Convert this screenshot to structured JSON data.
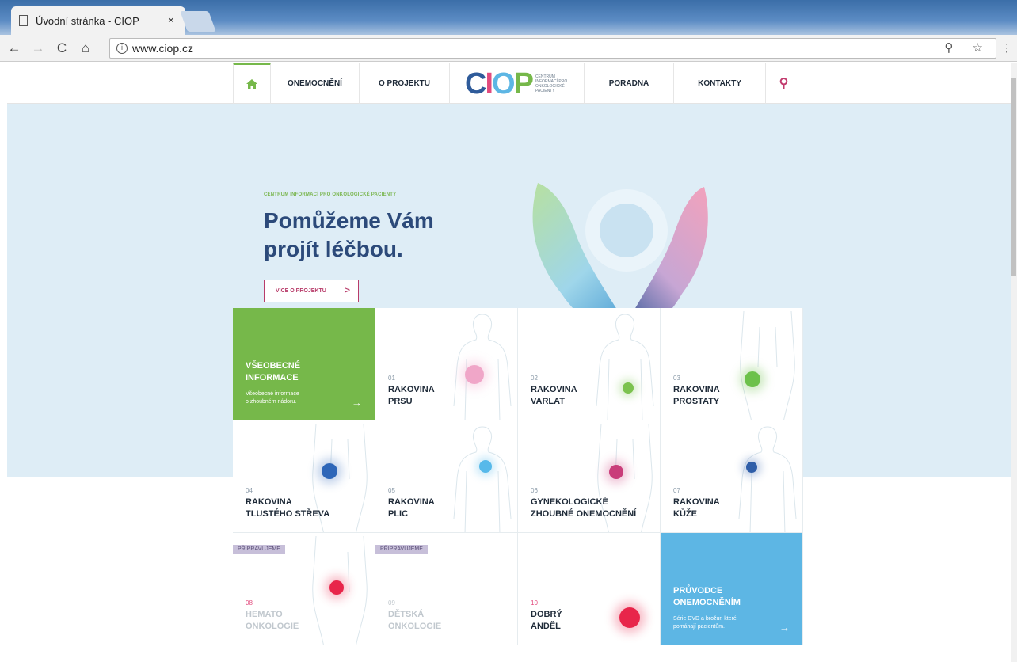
{
  "browser": {
    "tab_title": "Úvodní stránka - CIOP",
    "tab_close": "×",
    "url": "www.ciop.cz",
    "info_glyph": "i",
    "right_icons": "⚲ ☆",
    "menu_glyph": "⋮",
    "nav": {
      "back": "←",
      "forward": "→",
      "reload": "C",
      "home": "⌂"
    }
  },
  "nav": {
    "home_icon": "home-icon",
    "items": [
      "ONEMOCNĚNÍ",
      "O PROJEKTU",
      "PORADNA",
      "KONTAKTY"
    ],
    "search_icon": "search-icon",
    "search_glyph": "⚲"
  },
  "logo": {
    "text": "CIOP",
    "tagline": "CENTRUM INFORMACÍ PRO ONKOLOGICKÉ PACIENTY",
    "colors": [
      "#2f5b9a",
      "#e24a7d",
      "#5db6e4",
      "#76b84a"
    ]
  },
  "hero": {
    "kicker": "CENTRUM INFORMACÍ PRO ONKOLOGICKÉ PACIENTY",
    "headline_line1": "Pomůžeme Vám",
    "headline_line2": "projít léčbou.",
    "cta_label": "VÍCE O PROJEKTU",
    "cta_arrow": ">"
  },
  "cards": {
    "general": {
      "title_line1": "VŠEOBECNÉ",
      "title_line2": "INFORMACE",
      "desc_line1": "Všeobecné informace",
      "desc_line2": "o zhoubném nádoru.",
      "arrow": "→"
    },
    "items": [
      {
        "num": "01",
        "line1": "RAKOVINA",
        "line2": "PRSU",
        "dot": "#f0a6c8"
      },
      {
        "num": "02",
        "line1": "RAKOVINA",
        "line2": "VARLAT",
        "dot": "#7cc24f"
      },
      {
        "num": "03",
        "line1": "RAKOVINA",
        "line2": "PROSTATY",
        "dot": "#6cc14a"
      },
      {
        "num": "04",
        "line1": "RAKOVINA",
        "line2": "TLUSTÉHO STŘEVA",
        "dot": "#2e66b8"
      },
      {
        "num": "05",
        "line1": "RAKOVINA",
        "line2": "PLIC",
        "dot": "#57b9ea"
      },
      {
        "num": "06",
        "line1": "GYNEKOLOGICKÉ",
        "line2": "ZHOUBNÉ ONEMOCNĚNÍ",
        "dot": "#c93d7a"
      },
      {
        "num": "07",
        "line1": "RAKOVINA",
        "line2": "KŮŽE",
        "dot": "#2f5ea8"
      },
      {
        "num": "08",
        "line1": "HEMATO",
        "line2": "ONKOLOGIE",
        "dot": "#e8254a",
        "badge": "PŘIPRAVUJEME"
      },
      {
        "num": "09",
        "line1": "DĚTSKÁ",
        "line2": "ONKOLOGIE",
        "badge": "PŘIPRAVUJEME"
      },
      {
        "num": "10",
        "line1": "DOBRÝ",
        "line2": "ANDĚL",
        "dot": "#e8254a"
      }
    ],
    "guide": {
      "title_line1": "PRŮVODCE",
      "title_line2": "ONEMOCNĚNÍM",
      "desc_line1": "Série DVD a brožur, které",
      "desc_line2": "pomáhají pacientům.",
      "arrow": "→"
    }
  }
}
